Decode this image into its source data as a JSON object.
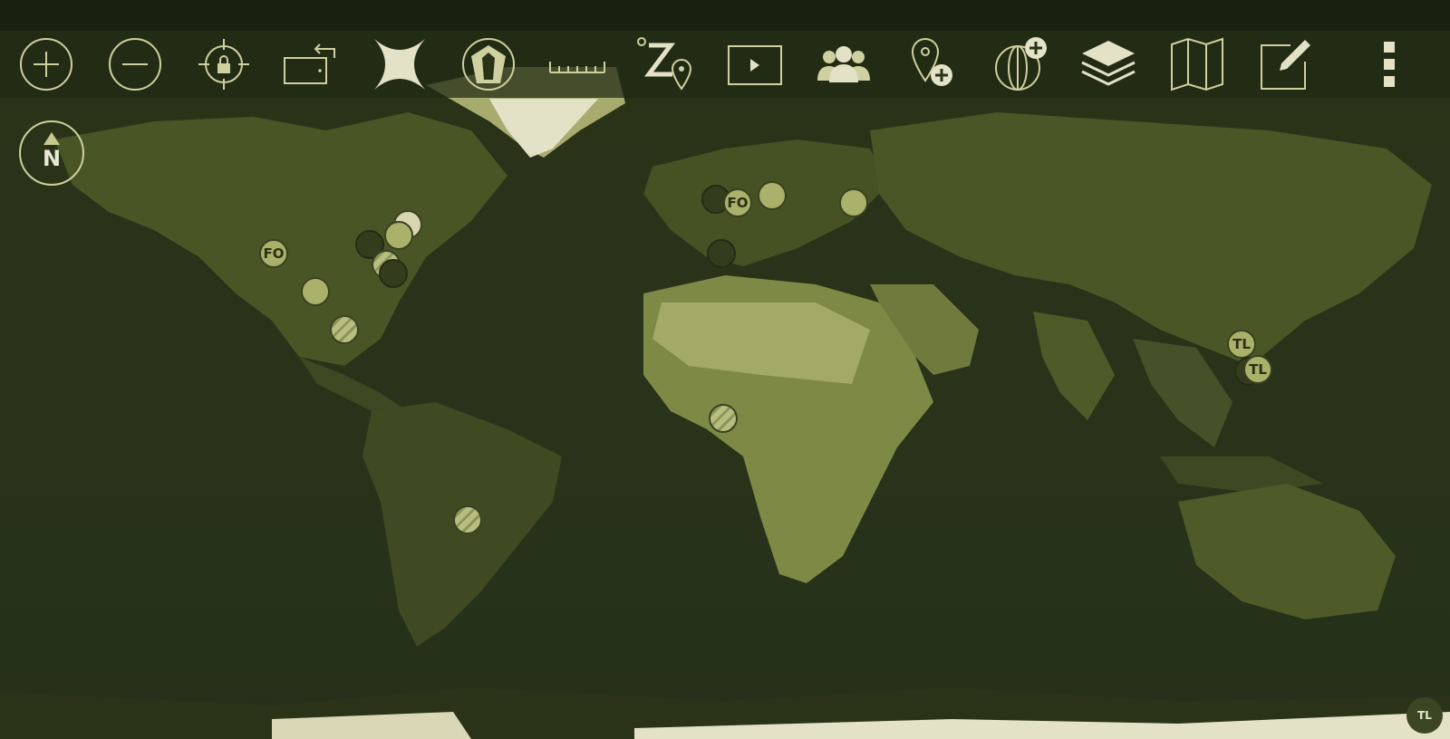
{
  "toolbar": {
    "tools": [
      {
        "name": "zoom-in-icon"
      },
      {
        "name": "zoom-out-icon"
      },
      {
        "name": "lock-location-icon"
      },
      {
        "name": "rotate-screen-icon"
      },
      {
        "name": "crosshair-x-icon"
      },
      {
        "name": "compass-rose-icon"
      },
      {
        "name": "ruler-icon"
      },
      {
        "name": "zoom-to-location-icon"
      },
      {
        "name": "play-video-icon"
      },
      {
        "name": "contacts-icon"
      },
      {
        "name": "add-point-icon"
      },
      {
        "name": "add-globe-icon"
      },
      {
        "name": "layers-icon"
      },
      {
        "name": "map-icon"
      },
      {
        "name": "edit-icon"
      },
      {
        "name": "more-menu-icon"
      }
    ]
  },
  "compass": {
    "label": "N"
  },
  "markers": [
    {
      "label": "FO"
    },
    {
      "label": "FO"
    },
    {
      "label": "TL"
    },
    {
      "label": "TL"
    }
  ],
  "badge": {
    "label": "TL"
  },
  "colors": {
    "map_tint": "#2a3318",
    "icon": "#cfd0a0",
    "marker_light": "#a9b16a",
    "marker_dark": "#343c1e"
  }
}
